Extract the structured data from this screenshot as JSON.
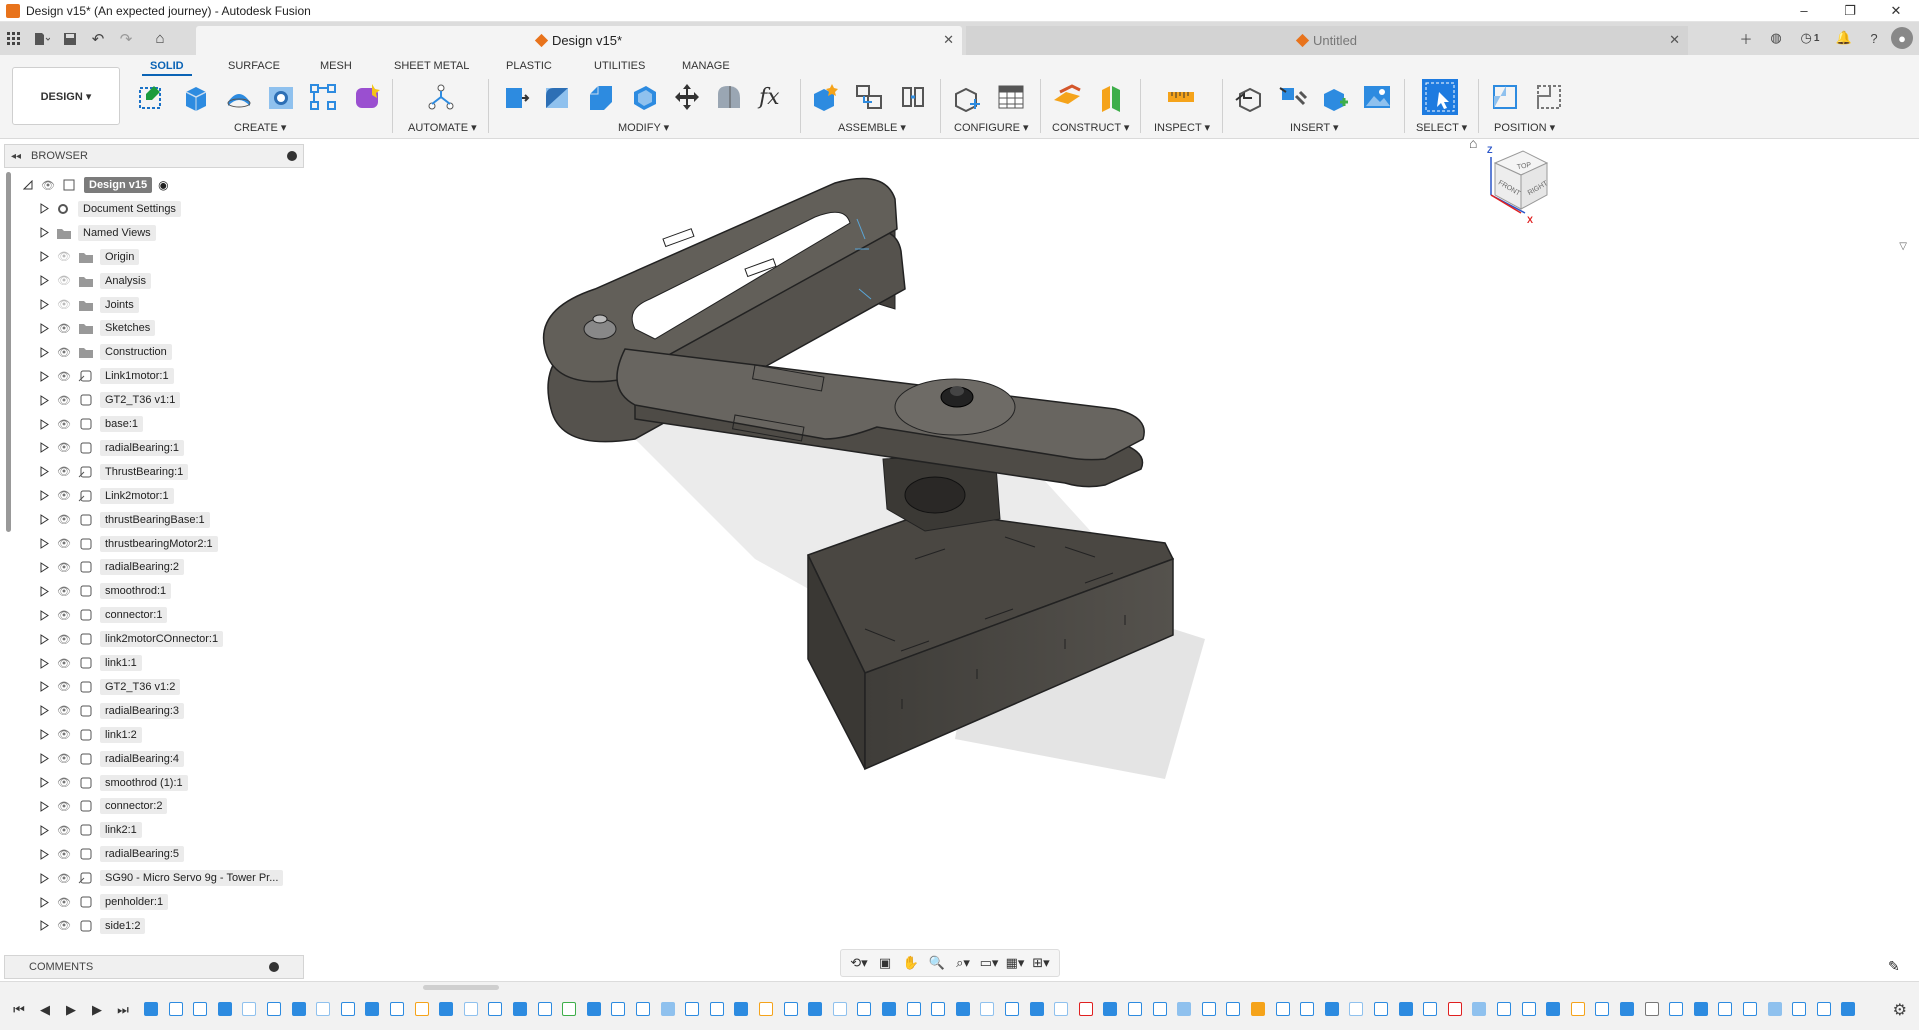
{
  "window": {
    "title": "Design v15* (An expected journey) - Autodesk Fusion",
    "controls": [
      "–",
      "❐",
      "✕"
    ]
  },
  "tabs": [
    {
      "label": "Design v15*",
      "active": true
    },
    {
      "label": "Untitled",
      "active": false
    }
  ],
  "appbar": {
    "job_count": "1"
  },
  "workspace": {
    "label": "DESIGN ▾"
  },
  "ribbon_tabs": [
    "SOLID",
    "SURFACE",
    "MESH",
    "SHEET METAL",
    "PLASTIC",
    "UTILITIES",
    "MANAGE"
  ],
  "ribbon_groups": [
    {
      "label": "CREATE ▾"
    },
    {
      "label": "AUTOMATE ▾"
    },
    {
      "label": "MODIFY ▾"
    },
    {
      "label": "ASSEMBLE ▾"
    },
    {
      "label": "CONFIGURE ▾"
    },
    {
      "label": "CONSTRUCT ▾"
    },
    {
      "label": "INSPECT ▾"
    },
    {
      "label": "INSERT ▾"
    },
    {
      "label": "SELECT ▾"
    },
    {
      "label": "POSITION ▾"
    }
  ],
  "browser": {
    "title": "BROWSER",
    "root": "Design v15",
    "items": [
      {
        "label": "Document Settings",
        "icon": "gear-icon"
      },
      {
        "label": "Named Views",
        "icon": "folder-icon"
      },
      {
        "label": "Origin",
        "icon": "folder-icon",
        "hidden": true
      },
      {
        "label": "Analysis",
        "icon": "folder-icon",
        "hidden": true
      },
      {
        "label": "Joints",
        "icon": "folder-icon",
        "hidden": true
      },
      {
        "label": "Sketches",
        "icon": "folder-icon"
      },
      {
        "label": "Construction",
        "icon": "folder-icon"
      },
      {
        "label": "Link1motor:1",
        "icon": "linked-component-icon"
      },
      {
        "label": "GT2_T36 v1:1",
        "icon": "component-icon"
      },
      {
        "label": "base:1",
        "icon": "component-icon"
      },
      {
        "label": "radialBearing:1",
        "icon": "component-icon"
      },
      {
        "label": "ThrustBearing:1",
        "icon": "linked-component-icon"
      },
      {
        "label": "Link2motor:1",
        "icon": "linked-component-icon"
      },
      {
        "label": "thrustBearingBase:1",
        "icon": "component-icon"
      },
      {
        "label": "thrustbearingMotor2:1",
        "icon": "component-icon"
      },
      {
        "label": "radialBearing:2",
        "icon": "component-icon"
      },
      {
        "label": "smoothrod:1",
        "icon": "component-icon"
      },
      {
        "label": "connector:1",
        "icon": "component-icon"
      },
      {
        "label": "link2motorCOnnector:1",
        "icon": "component-icon"
      },
      {
        "label": "link1:1",
        "icon": "component-icon"
      },
      {
        "label": "GT2_T36 v1:2",
        "icon": "component-icon"
      },
      {
        "label": "radialBearing:3",
        "icon": "component-icon"
      },
      {
        "label": "link1:2",
        "icon": "component-icon"
      },
      {
        "label": "radialBearing:4",
        "icon": "component-icon"
      },
      {
        "label": "smoothrod (1):1",
        "icon": "component-icon"
      },
      {
        "label": "connector:2",
        "icon": "component-icon"
      },
      {
        "label": "link2:1",
        "icon": "component-icon"
      },
      {
        "label": "radialBearing:5",
        "icon": "component-icon"
      },
      {
        "label": "SG90 - Micro Servo 9g - Tower Pr...",
        "icon": "linked-component-icon"
      },
      {
        "label": "penholder:1",
        "icon": "component-icon"
      },
      {
        "label": "side1:2",
        "icon": "component-icon"
      }
    ]
  },
  "comments": {
    "title": "COMMENTS"
  },
  "viewcube": {
    "top": "TOP",
    "front": "FRONT",
    "right": "RIGHT",
    "z": "Z",
    "x": "X"
  },
  "colors": {
    "accent": "#0a63b5",
    "orange": "#e8731c",
    "model": "#4a4742"
  }
}
